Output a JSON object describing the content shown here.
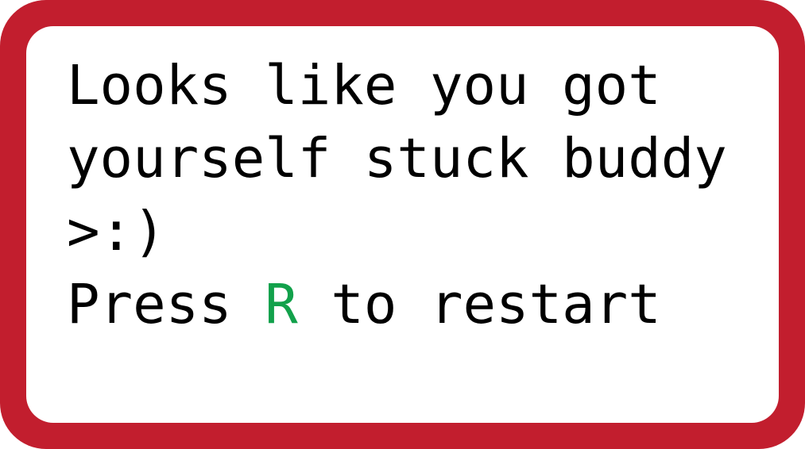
{
  "dialog": {
    "line1": "Looks like you got",
    "line2": "yourself stuck buddy",
    "line3": ">:)",
    "restart_prefix": "Press ",
    "restart_key": "R",
    "restart_suffix": " to restart"
  },
  "colors": {
    "border": "#c21e2e",
    "panel": "#ffffff",
    "text": "#000000",
    "key": "#12a14b"
  }
}
